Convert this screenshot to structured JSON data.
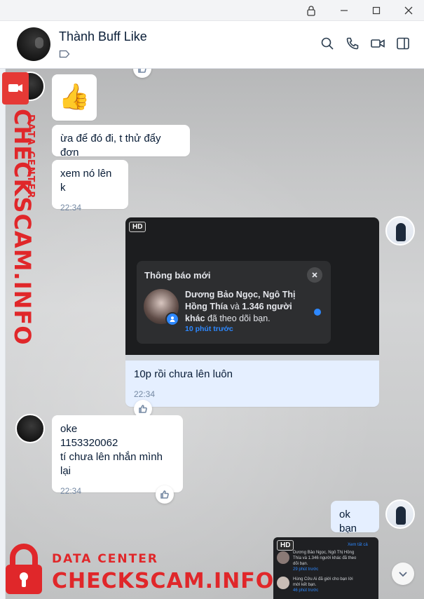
{
  "header": {
    "contact_name": "Thành Buff Like"
  },
  "messages": {
    "m1_emoji": "👍",
    "m2_text": "ừa để đó đi, t thử đẩy đơn",
    "m3_text": "xem nó lên k",
    "m3_time": "22:34",
    "m4_caption": "10p rồi chưa lên luôn",
    "m4_time": "22:34",
    "m5_line1": "oke",
    "m5_line2": "1153320062",
    "m5_line3": "tí chưa lên nhắn mình lại",
    "m5_time": "22:34",
    "m6_text": "ok bạn"
  },
  "screenshot1": {
    "hd": "HD",
    "notif_title": "Thông báo mới",
    "notif_names": "Dương Bảo Ngọc, Ngô Thị Hồng Thía",
    "notif_and": "và",
    "notif_count": "1.346 người khác",
    "notif_action": "đã theo dõi bạn.",
    "notif_time": "10 phút trước"
  },
  "screenshot2": {
    "hd": "HD",
    "see_all": "Xem tất cả",
    "line1": "Dương Bảo Ngọc, Ngô Thị Hồng",
    "line2": "Thía và 1.346 người khác đã theo",
    "line3": "dõi bạn.",
    "time1": "29 phút trước",
    "line4": "Hùng Cửu Ai đã giới cho bạn lời",
    "line5": "mời kết bạn.",
    "time2": "46 phút trước"
  },
  "watermark": {
    "vertical_brand": "CHECKSCAM.INFO",
    "vertical_sub": "DATA CENTER",
    "bottom_sub": "DATA CENTER",
    "bottom_brand": "CHECKSCAM.INFO"
  },
  "colors": {
    "accent": "#0068ff",
    "watermark_red": "#e0272a",
    "my_bubble": "#e5efff"
  }
}
